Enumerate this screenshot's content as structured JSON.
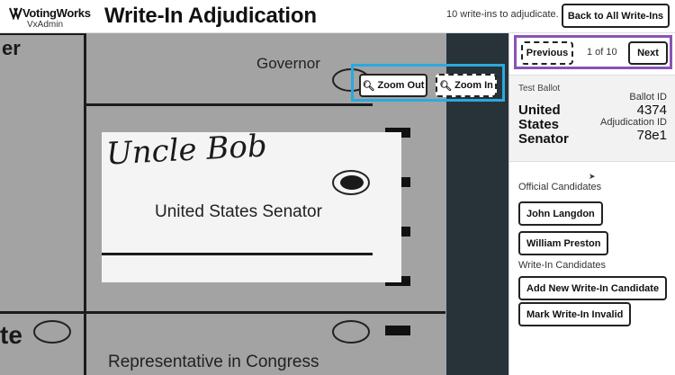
{
  "header": {
    "brand": "VotingWorks",
    "product": "VxAdmin",
    "title": "Write-In Adjudication",
    "status": "10 write-ins to adjudicate.",
    "back_label": "Back to All Write-Ins"
  },
  "viewer": {
    "zoom_out_label": "Zoom Out",
    "zoom_in_label": "Zoom In",
    "scan": {
      "governor_heading": "Governor",
      "senator_heading": "United States Senator",
      "rep_heading": "Representative in Congress",
      "handwritten_name": "Uncle Bob"
    }
  },
  "navigation": {
    "previous_label": "Previous",
    "current": 1,
    "total": 10,
    "position_text": "1 of 10",
    "next_label": "Next"
  },
  "ballot_info": {
    "ballot_type": "Test Ballot",
    "contest": "United States Senator",
    "ballot_id_label": "Ballot ID",
    "ballot_id": "4374",
    "adjudication_id_label": "Adjudication ID",
    "adjudication_id": "78e1"
  },
  "official_candidates": {
    "label": "Official Candidates",
    "items": [
      "John Langdon",
      "William Preston"
    ]
  },
  "write_in_candidates": {
    "label": "Write-In Candidates",
    "add_label": "Add New Write-In Candidate",
    "invalid_label": "Mark Write-In Invalid"
  },
  "colors": {
    "zoom_focus": "#2aa9e0",
    "nav_focus": "#8a53b6",
    "viewer_bg": "#273339"
  }
}
